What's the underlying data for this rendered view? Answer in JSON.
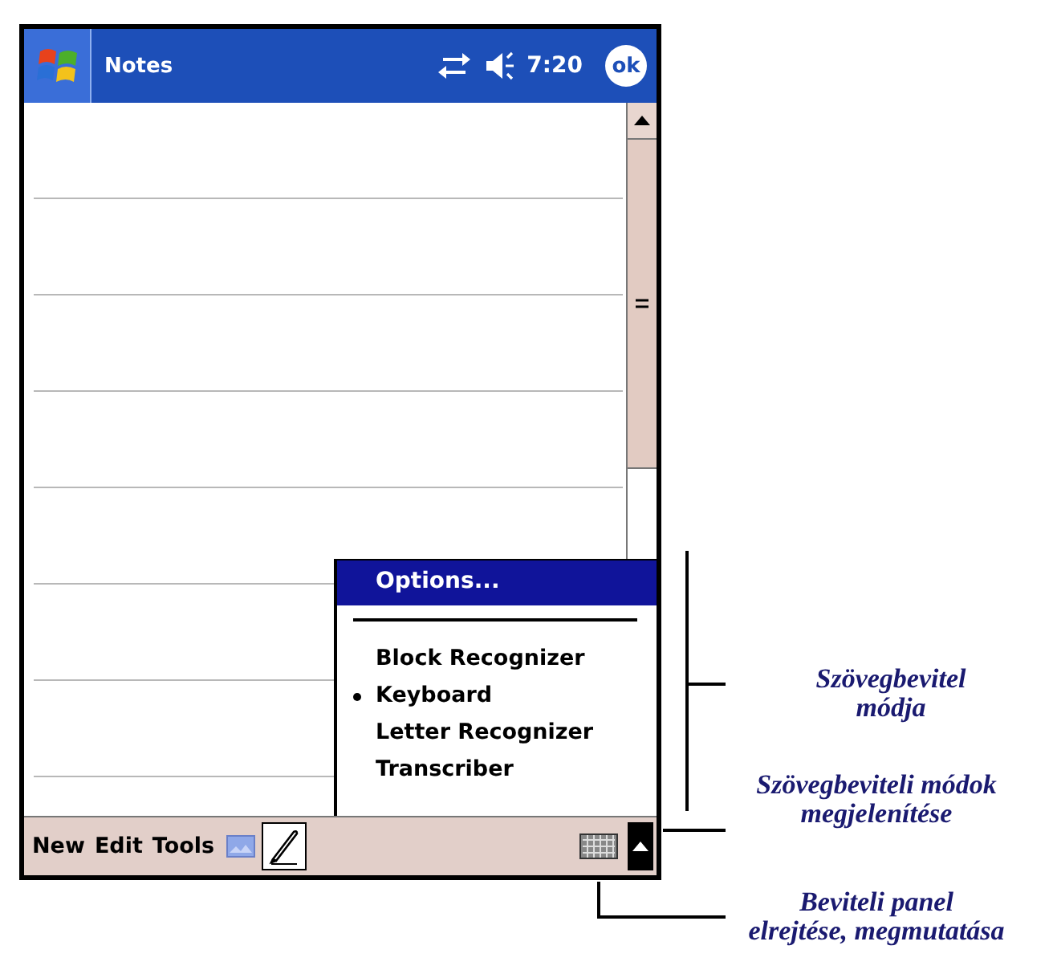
{
  "title_bar": {
    "title": "Notes",
    "time": "7:20",
    "ok_button": "ok"
  },
  "input_menu": {
    "header": "Options...",
    "items": [
      {
        "label": "Block Recognizer",
        "selected": false
      },
      {
        "label": "Keyboard",
        "selected": true
      },
      {
        "label": "Letter Recognizer",
        "selected": false
      },
      {
        "label": "Transcriber",
        "selected": false
      }
    ]
  },
  "menu_bar": {
    "items": [
      "New",
      "Edit",
      "Tools"
    ]
  },
  "annotations": [
    {
      "text": "Szövegbevitel\nmódja"
    },
    {
      "text": "Szövegbeviteli módok\nmegjelenítése"
    },
    {
      "text": "Beviteli panel\nelrejtése, megmutatása"
    }
  ]
}
